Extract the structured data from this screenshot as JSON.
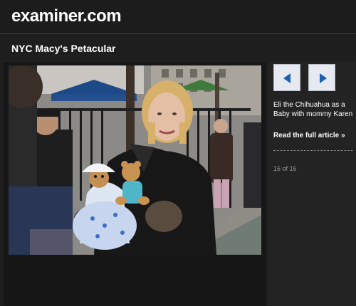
{
  "site": {
    "logo_prefix": "e",
    "logo_rest": "xaminer.com"
  },
  "gallery": {
    "title": "NYC Macy's Petacular",
    "caption": "Eli the Chihuahua as a Baby with mommy Karen",
    "read_more": "Read the full article »",
    "counter": "16 of 16"
  },
  "icons": {
    "prev": "arrow-left-icon",
    "next": "arrow-right-icon"
  },
  "colors": {
    "background": "#1e1e1e",
    "nav_button": "#e6e9ef",
    "arrow": "#1f5fb0",
    "muted_text": "#9a9a9a"
  }
}
